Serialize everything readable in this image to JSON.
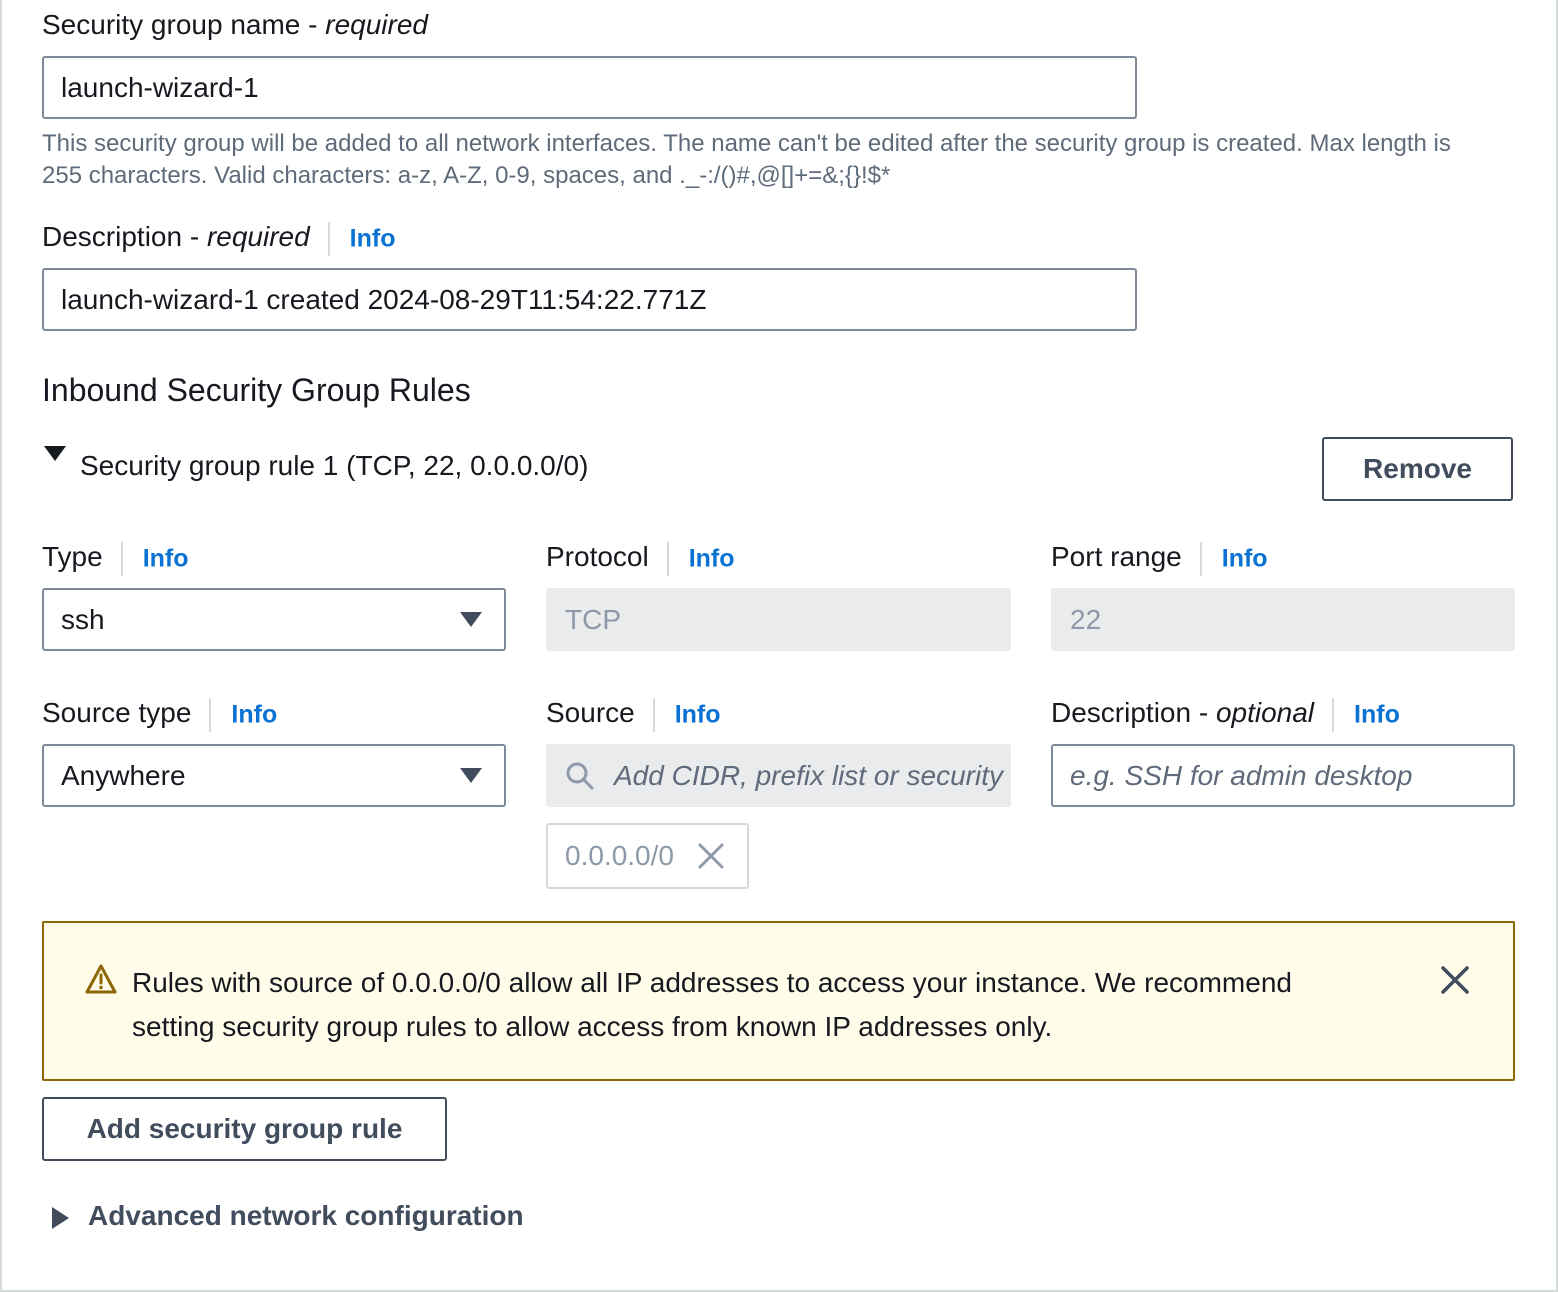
{
  "group_name": {
    "label": "Security group name - ",
    "label_required": "required",
    "value": "launch-wizard-1",
    "helper_line1": "This security group will be added to all network interfaces. The name can't be edited after the security group is created. Max length is",
    "helper_line2": "255 characters. Valid characters: a-z, A-Z, 0-9, spaces, and ._-:/()#,@[]+=&;{}!$*"
  },
  "description": {
    "label": "Description - ",
    "label_required": "required",
    "info": "Info",
    "value": "launch-wizard-1 created 2024-08-29T11:54:22.771Z"
  },
  "inbound": {
    "title": "Inbound Security Group Rules",
    "rule": {
      "title": "Security group rule 1 (TCP, 22, 0.0.0.0/0)",
      "remove_label": "Remove",
      "type": {
        "label": "Type",
        "info": "Info",
        "value": "ssh"
      },
      "protocol": {
        "label": "Protocol",
        "info": "Info",
        "value": "TCP"
      },
      "port_range": {
        "label": "Port range",
        "info": "Info",
        "value": "22"
      },
      "source_type": {
        "label": "Source type",
        "info": "Info",
        "value": "Anywhere"
      },
      "source": {
        "label": "Source",
        "info": "Info",
        "placeholder": "Add CIDR, prefix list or security",
        "token": "0.0.0.0/0"
      },
      "rule_description": {
        "label": "Description - ",
        "label_optional": "optional",
        "info": "Info",
        "placeholder": "e.g. SSH for admin desktop"
      }
    }
  },
  "warning": {
    "line1": "Rules with source of 0.0.0.0/0 allow all IP addresses to access your instance. We recommend",
    "line2": "setting security group rules to allow access from known IP addresses only."
  },
  "add_rule_label": "Add security group rule",
  "advanced_label": "Advanced network configuration",
  "colors": {
    "link": "#0972d3",
    "warning_bg": "#fffce9",
    "warning_border": "#8d6605",
    "text": "#16191f"
  }
}
